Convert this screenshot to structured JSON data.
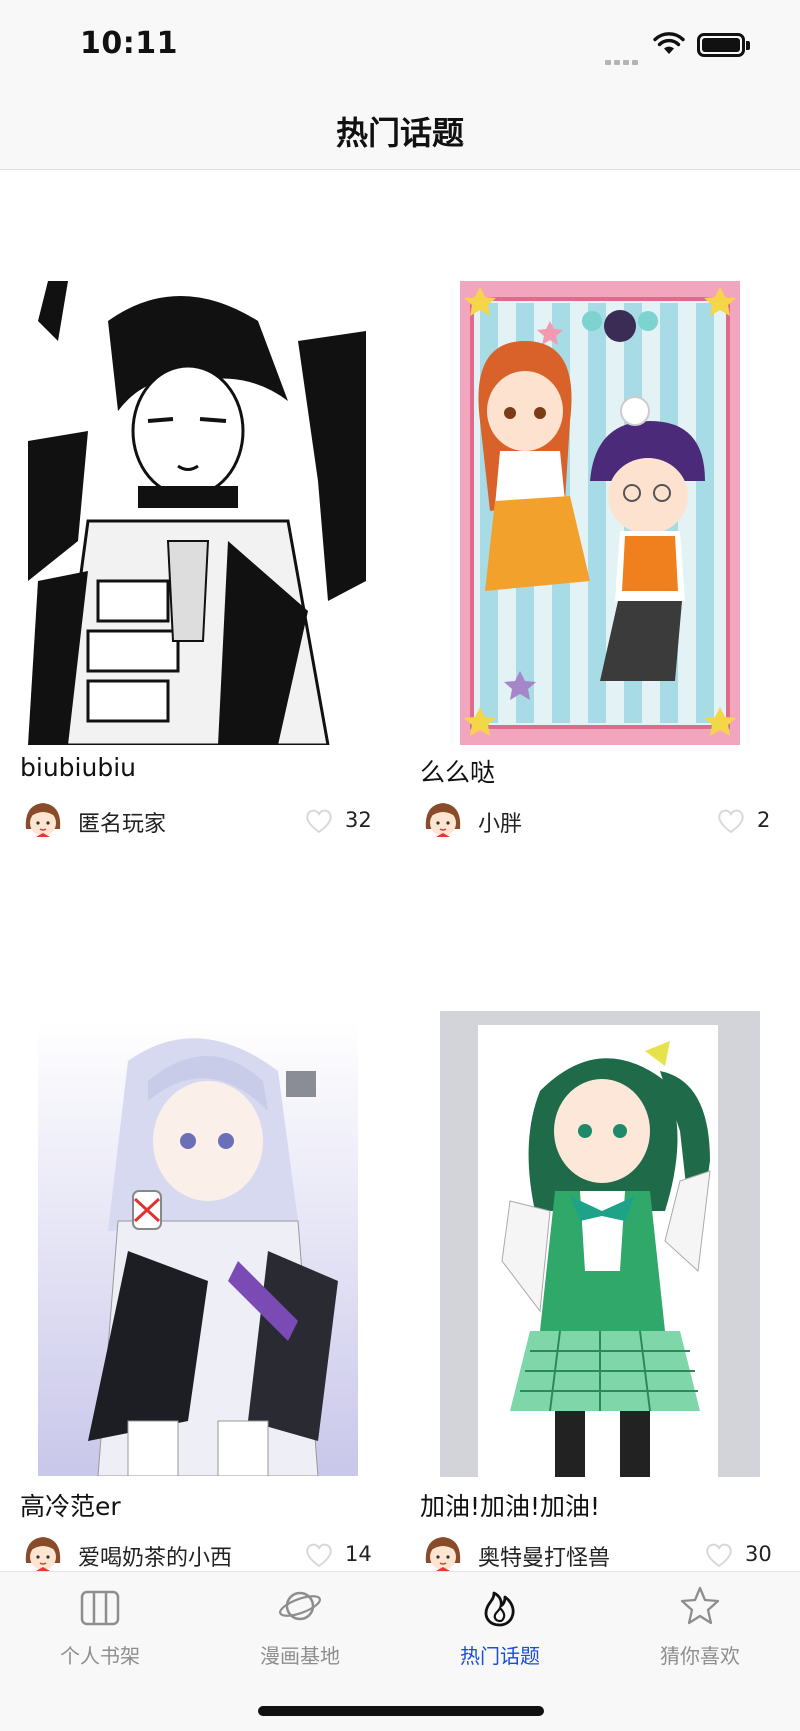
{
  "status_bar": {
    "time": "10:11"
  },
  "nav": {
    "title": "热门话题"
  },
  "cards": [
    {
      "title": "biubiubiu",
      "author": "匿名玩家",
      "likes": "32",
      "image_theme": "black-white-manga"
    },
    {
      "title": "么么哒",
      "author": "小胖",
      "likes": "2",
      "image_theme": "pink-frame-chibi"
    },
    {
      "title": "高冷范er",
      "author": "爱喝奶茶的小西",
      "likes": "14",
      "image_theme": "silver-hair-anime"
    },
    {
      "title": "加油!加油!加油!",
      "author": "奥特曼打怪兽",
      "likes": "30",
      "image_theme": "green-uniform-anime"
    }
  ],
  "tab_bar": {
    "items": [
      {
        "label": "个人书架",
        "icon": "bookshelf-icon",
        "active": false
      },
      {
        "label": "漫画基地",
        "icon": "planet-icon",
        "active": false
      },
      {
        "label": "热门话题",
        "icon": "flame-icon",
        "active": true
      },
      {
        "label": "猜你喜欢",
        "icon": "star-icon",
        "active": false
      }
    ]
  },
  "colors": {
    "accent": "#1a4fd6",
    "tab_inactive": "#8e8e8e",
    "background": "#ffffff",
    "bar_background": "#f8f8f8"
  }
}
